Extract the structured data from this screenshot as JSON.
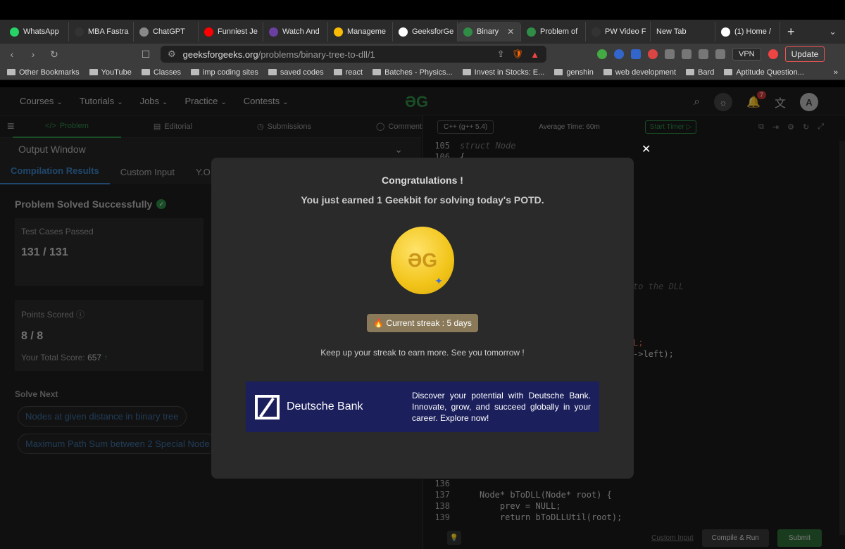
{
  "browser": {
    "tabs": [
      {
        "label": "WhatsApp",
        "color": "#25d366"
      },
      {
        "label": "MBA Fastra",
        "color": "#333333"
      },
      {
        "label": "ChatGPT",
        "color": "#888888"
      },
      {
        "label": "Funniest Je",
        "color": "#ff0000"
      },
      {
        "label": "Watch And",
        "color": "#6b3fa0"
      },
      {
        "label": "Manageme",
        "color": "#fbbc04"
      },
      {
        "label": "GeeksforGe",
        "color": "#ffffff"
      },
      {
        "label": "Binary",
        "color": "#2f8d46"
      },
      {
        "label": "Problem of",
        "color": "#2f8d46"
      },
      {
        "label": "PW Video F",
        "color": "#333333"
      },
      {
        "label": "New Tab",
        "color": ""
      },
      {
        "label": "(1) Home /",
        "color": "#ffffff"
      }
    ],
    "active_tab_index": 7,
    "url_host": "geeksforgeeks.org",
    "url_path": "/problems/binary-tree-to-dll/1",
    "vpn_label": "VPN",
    "update_label": "Update",
    "bookmarks": [
      "Other Bookmarks",
      "YouTube",
      "Classes",
      "imp coding sites",
      "saved codes",
      "react",
      "Batches - Physics...",
      "Invest in Stocks: E...",
      "genshin",
      "web development",
      "Bard",
      "Aptitude Question..."
    ]
  },
  "site": {
    "nav": [
      "Courses",
      "Tutorials",
      "Jobs",
      "Practice",
      "Contests"
    ],
    "logo": "ƏG",
    "notif_count": "7",
    "avatar_letter": "A"
  },
  "problem": {
    "subtabs": [
      "Problem",
      "Editorial",
      "Submissions",
      "Comments"
    ],
    "output_window": "Output Window",
    "result_tabs": [
      "Compilation Results",
      "Custom Input",
      "Y.O.G.I"
    ],
    "solved": "Problem Solved Successfully",
    "test_cases_label": "Test Cases Passed",
    "test_cases_value": "131 / 131",
    "points_label": "Points Scored",
    "points_value": "8 / 8",
    "total_score_label": "Your Total Score:",
    "total_score_value": "657",
    "solve_next": "Solve Next",
    "next_problems": [
      "Nodes at given distance in binary tree",
      "Maximum Path Sum between 2 Special Node"
    ]
  },
  "editor": {
    "language": "C++ (g++ 5.4)",
    "avg_time": "Average Time: 60m",
    "start_timer": "Start Timer",
    "lines_top": [
      {
        "n": "105",
        "t": "struct Node"
      },
      {
        "n": "106",
        "t": "{"
      }
    ],
    "fragments": [
      {
        "t": "to the DLL"
      },
      {
        "t": "L;"
      },
      {
        "t": "->left);"
      }
    ],
    "lines_bottom": [
      {
        "n": "136",
        "t": ""
      },
      {
        "n": "137",
        "t": "Node* bToDLL(Node* root) {"
      },
      {
        "n": "138",
        "t": "    prev = NULL;"
      },
      {
        "n": "139",
        "t": "    return bToDLLUtil(root);"
      }
    ],
    "custom_input": "Custom Input",
    "compile_run": "Compile & Run",
    "submit": "Submit"
  },
  "modal": {
    "title": "Congratulations !",
    "subtitle": "You just earned 1 Geekbit for solving today's POTD.",
    "streak": "🔥 Current streak : 5 days",
    "keep": "Keep up your streak to earn more. See you tomorrow !",
    "ad_brand": "Deutsche Bank",
    "ad_text": "Discover your potential with Deutsche Bank. Innovate, grow, and succeed globally in your career. Explore now!"
  }
}
